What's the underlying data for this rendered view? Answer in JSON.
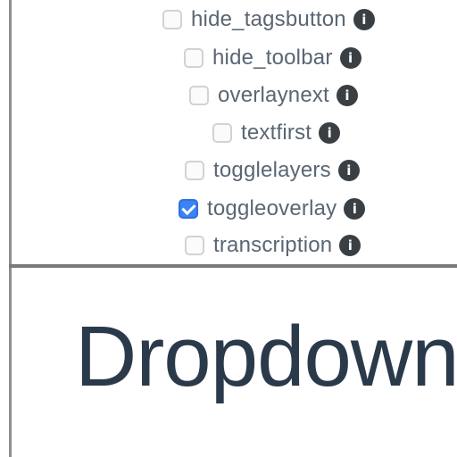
{
  "options": [
    {
      "label": "hide_tagsbutton",
      "checked": false
    },
    {
      "label": "hide_toolbar",
      "checked": false
    },
    {
      "label": "overlaynext",
      "checked": false
    },
    {
      "label": "textfirst",
      "checked": false
    },
    {
      "label": "togglelayers",
      "checked": false
    },
    {
      "label": "toggleoverlay",
      "checked": true
    },
    {
      "label": "transcription",
      "checked": false
    }
  ],
  "info_icon_glyph": "i",
  "section": {
    "heading": "Dropdowns"
  }
}
